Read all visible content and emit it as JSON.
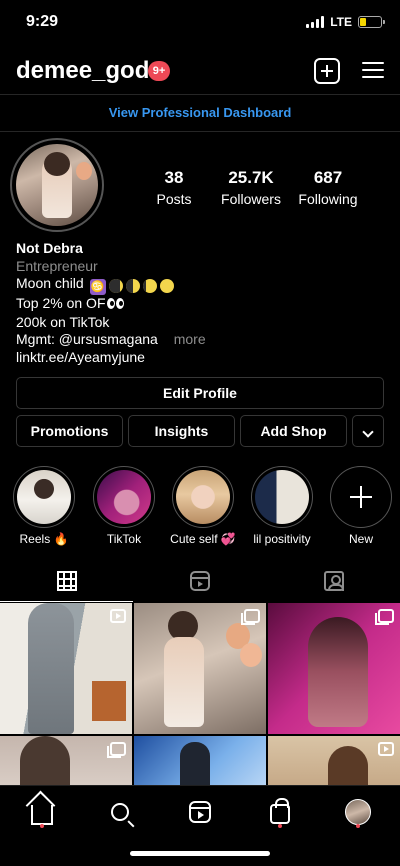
{
  "status_bar": {
    "time": "9:29",
    "network": "LTE",
    "battery_color": "#f5d600"
  },
  "header": {
    "username": "demee_god",
    "notifications_badge": "9+",
    "badge_color": "#ed4956"
  },
  "dashboard_link": "View Professional Dashboard",
  "accent_color": "#3897f0",
  "stats": [
    {
      "value": "38",
      "label": "Posts"
    },
    {
      "value": "25.7K",
      "label": "Followers"
    },
    {
      "value": "687",
      "label": "Following"
    }
  ],
  "bio": {
    "name": "Not Debra",
    "category": "Entrepreneur",
    "line1": "Moon child",
    "line2": "Top 2% on OF",
    "line3": "200k on TikTok",
    "line4": "Mgmt: @ursusmagana",
    "more": "more",
    "link": "linktr.ee/Ayeamyjune"
  },
  "buttons": {
    "edit_profile": "Edit Profile",
    "promotions": "Promotions",
    "insights": "Insights",
    "add_shop": "Add Shop"
  },
  "highlights": [
    {
      "label": "Reels 🔥"
    },
    {
      "label": "TikTok"
    },
    {
      "label": "Cute self 💞"
    },
    {
      "label": "lil positivity"
    },
    {
      "label": "New"
    }
  ],
  "tabs": [
    "grid-icon",
    "reels-icon",
    "tagged-icon"
  ],
  "bottom_nav": [
    "home-icon",
    "search-icon",
    "reels-icon",
    "shop-icon",
    "profile-avatar"
  ]
}
